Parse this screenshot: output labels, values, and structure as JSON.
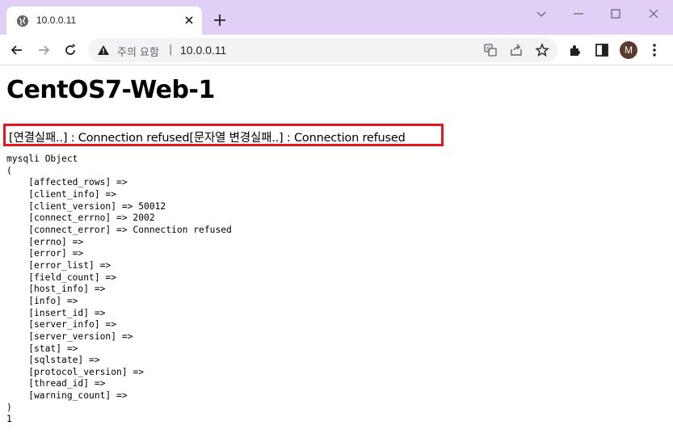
{
  "browser": {
    "tab_title": "10.0.0.11",
    "omnibox": {
      "warning_text": "주의 요함",
      "separator": "|",
      "url": "10.0.0.11"
    },
    "profile_initial": "M",
    "colors": {
      "tabstrip": "#e0d0f5",
      "toolbar": "#ffffff",
      "omnibox": "#f1f3f4",
      "avatar": "#5d3a2e"
    }
  },
  "page": {
    "title": "CentOS7-Web-1",
    "error_message": "[연결실패..] : Connection refused[문자열 변경실패..] : Connection refused",
    "error_box_color": "#e8141c",
    "dump_lines": [
      "mysqli Object",
      "(",
      "    [affected_rows] =>",
      "    [client_info] =>",
      "    [client_version] => 50012",
      "    [connect_errno] => 2002",
      "    [connect_error] => Connection refused",
      "    [errno] =>",
      "    [error] =>",
      "    [error_list] =>",
      "    [field_count] =>",
      "    [host_info] =>",
      "    [info] =>",
      "    [insert_id] =>",
      "    [server_info] =>",
      "    [server_version] =>",
      "    [stat] =>",
      "    [sqlstate] =>",
      "    [protocol_version] =>",
      "    [thread_id] =>",
      "    [warning_count] =>",
      ")",
      "1"
    ]
  }
}
